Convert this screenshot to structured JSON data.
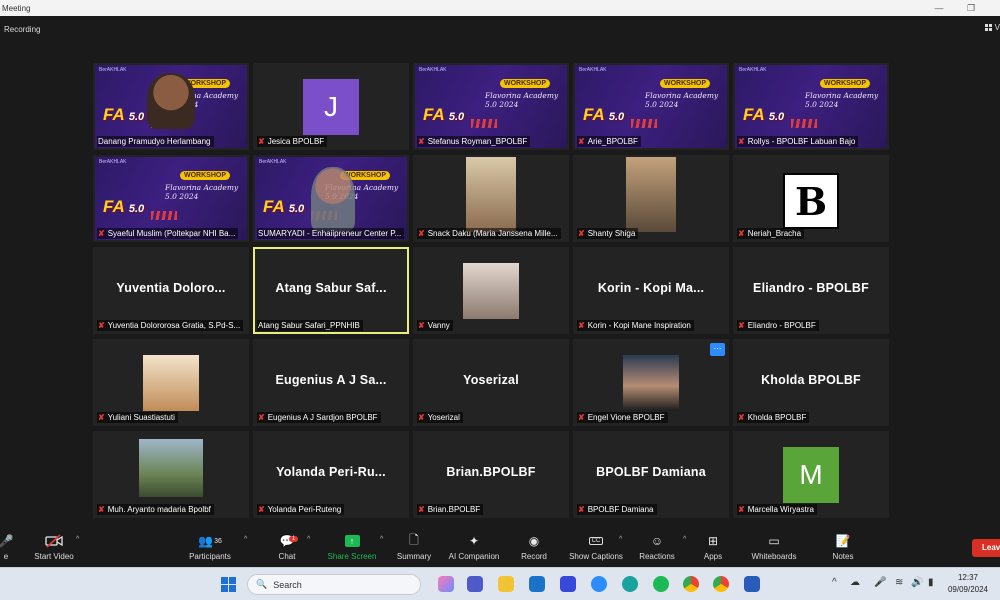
{
  "window": {
    "title": "Meeting"
  },
  "meeting": {
    "recording_label": "Recording",
    "view_label": "V"
  },
  "participants": [
    {
      "display": "slide",
      "name": "Danang Pramudyo Herlambang",
      "muted": false,
      "bigname": ""
    },
    {
      "display": "initial",
      "initial": "J",
      "initial_color": "#7b4fc9",
      "name": "Jesica BPOLBF",
      "muted": true,
      "bigname": ""
    },
    {
      "display": "slide",
      "name": "Stefanus Royman_BPOLBF",
      "muted": true,
      "bigname": ""
    },
    {
      "display": "slide",
      "name": "Arie_BPOLBF",
      "muted": true,
      "bigname": ""
    },
    {
      "display": "slide",
      "name": "Rollys - BPOLBF Labuan Bajo",
      "muted": true,
      "bigname": ""
    },
    {
      "display": "slide",
      "name": "Syaeful Muslim (Poltekpar NHI Ba...",
      "muted": true,
      "bigname": ""
    },
    {
      "display": "slide",
      "name": "SUMARYADI - Enhaiipreneur Center P...",
      "muted": false,
      "bigname": ""
    },
    {
      "display": "photo",
      "name": "Snack Daku (Maria Janssena Mille...",
      "muted": true,
      "bigname": ""
    },
    {
      "display": "photo",
      "name": "Shanty Shiga",
      "muted": true,
      "bigname": ""
    },
    {
      "display": "logo",
      "logo_text": "B",
      "name": "Neriah_Bracha",
      "muted": true,
      "bigname": ""
    },
    {
      "display": "name",
      "name": "Yuventia Dolororosa Gratia, S.Pd-S...",
      "muted": true,
      "bigname": "Yuventia Doloro..."
    },
    {
      "display": "name",
      "name": "Atang Sabur Safari_PPNHIB",
      "muted": false,
      "bigname": "Atang Sabur Saf...",
      "active": true
    },
    {
      "display": "photo",
      "name": "Vanny",
      "muted": true,
      "bigname": ""
    },
    {
      "display": "name",
      "name": "Korin - Kopi Mane Inspiration",
      "muted": true,
      "bigname": "Korin - Kopi Ma..."
    },
    {
      "display": "name",
      "name": "Eliandro - BPOLBF",
      "muted": true,
      "bigname": "Eliandro - BPOLBF"
    },
    {
      "display": "photo",
      "name": "Yuliani Suastiastuti",
      "muted": true,
      "bigname": ""
    },
    {
      "display": "name",
      "name": "Eugenius A J Sardjon BPOLBF",
      "muted": true,
      "bigname": "Eugenius A J Sa..."
    },
    {
      "display": "name",
      "name": "Yoserizal",
      "muted": true,
      "bigname": "Yoserizal"
    },
    {
      "display": "photo",
      "name": "Engel Vione BPOLBF",
      "muted": true,
      "bigname": ""
    },
    {
      "display": "name",
      "name": "Kholda BPOLBF",
      "muted": true,
      "bigname": "Kholda BPOLBF"
    },
    {
      "display": "photo",
      "name": "Muh. Aryanto madaria Bpolbf",
      "muted": true,
      "bigname": ""
    },
    {
      "display": "name",
      "name": "Yolanda Peri-Ruteng",
      "muted": true,
      "bigname": "Yolanda Peri-Ru..."
    },
    {
      "display": "name",
      "name": "Brian.BPOLBF",
      "muted": true,
      "bigname": "Brian.BPOLBF"
    },
    {
      "display": "name",
      "name": "BPOLBF Damiana",
      "muted": true,
      "bigname": "BPOLBF Damiana"
    },
    {
      "display": "initial",
      "initial": "M",
      "initial_color": "#5aa539",
      "name": "Marcella Wiryastra",
      "muted": true,
      "bigname": ""
    }
  ],
  "slide": {
    "badge": "WORKSHOP",
    "subtitle": "Flavorina Academy 5.0 2024",
    "brand": "FA",
    "version": "5.0",
    "topline": "BerAKHLAK"
  },
  "toolbar": {
    "audio_label": "e",
    "start_video_label": "Start Video",
    "participants_label": "Participants",
    "participants_count": "36",
    "chat_label": "Chat",
    "chat_badge": "1",
    "share_label": "Share Screen",
    "summary_label": "Summary",
    "ai_label": "AI Companion",
    "record_label": "Record",
    "captions_label": "Show Captions",
    "captions_icon": "CC",
    "reactions_label": "Reactions",
    "apps_label": "Apps",
    "whiteboards_label": "Whiteboards",
    "notes_label": "Notes",
    "leave_label": "Leav"
  },
  "taskbar": {
    "search_placeholder": "Search",
    "time": "12:37",
    "date": "09/09/2024"
  },
  "icons": {
    "mic_off": "mic-off-icon",
    "video_off": "video-off-icon",
    "people": "participants-icon",
    "chat": "chat-icon",
    "share": "share-screen-icon",
    "summary": "summary-icon",
    "ai": "ai-companion-icon",
    "record": "record-icon",
    "reactions": "reactions-icon",
    "apps": "apps-icon",
    "whiteboard": "whiteboard-icon",
    "notes": "notes-icon"
  },
  "colors": {
    "active_speaker": "#e9f07a",
    "share_green": "#1db954",
    "leave_red": "#d93025",
    "mic_off_red": "#e53935"
  }
}
